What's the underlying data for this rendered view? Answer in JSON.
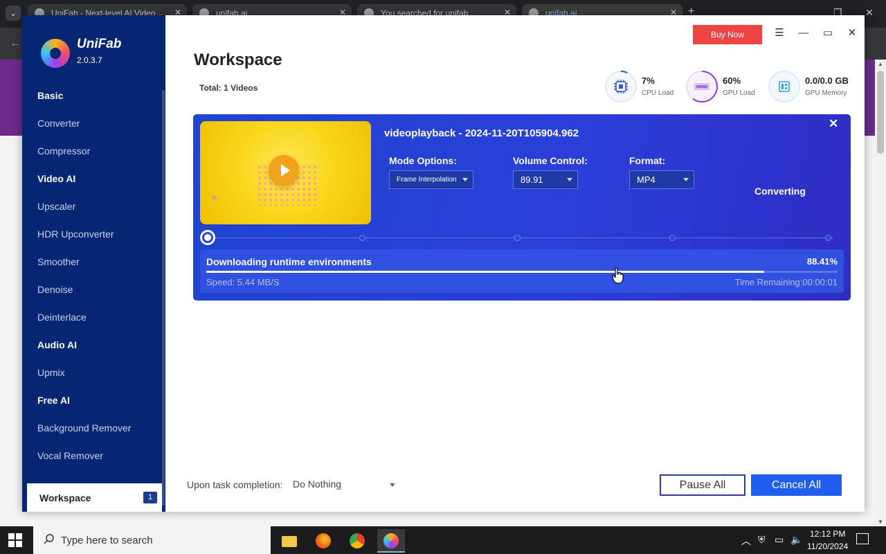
{
  "browser": {
    "tabs": [
      {
        "title": "UniFab - Next-level AI Video ...",
        "active": false
      },
      {
        "title": "unifab.ai",
        "active": false
      },
      {
        "title": "You searched for unifab ...",
        "active": false
      },
      {
        "title": "unifab.ai",
        "active": true
      }
    ]
  },
  "app": {
    "name": "UniFab",
    "version": "2.0.3.7",
    "buy_now": "Buy Now",
    "workspace_badge": "1"
  },
  "sidebar": {
    "sections": [
      {
        "title": "Basic",
        "items": [
          "Converter",
          "Compressor"
        ]
      },
      {
        "title": "Video AI",
        "items": [
          "Upscaler",
          "HDR Upconverter",
          "Smoother",
          "Denoise",
          "Deinterlace"
        ]
      },
      {
        "title": "Audio AI",
        "items": [
          "Upmix"
        ]
      },
      {
        "title": "Free AI",
        "items": [
          "Background Remover",
          "Vocal Remover"
        ]
      }
    ],
    "active_item": "Workspace"
  },
  "workspace": {
    "title": "Workspace",
    "total": "Total: 1 Videos"
  },
  "stats": [
    {
      "value": "7%",
      "label": "CPU Load",
      "percent": 7,
      "color": "#2a55d4"
    },
    {
      "value": "60%",
      "label": "GPU Load",
      "percent": 60,
      "color": "#8a3ed8"
    },
    {
      "value": "0.0/0.0 GB",
      "label": "GPU Memory",
      "percent": 0,
      "color": "#2aa6e8"
    }
  ],
  "task": {
    "video_name": "videoplayback - 2024-11-20T105904.962",
    "mode_label": "Mode Options:",
    "mode_value": "Frame Interpolation",
    "volume_label": "Volume Control:",
    "volume_value": "89.91",
    "format_label": "Format:",
    "format_value": "MP4",
    "status": "Converting",
    "progress_title": "Downloading runtime environments",
    "progress_percent_text": "88.41%",
    "progress_fraction": 0.8841,
    "speed": "Speed: 5.44 MB/S",
    "time_remaining": "Time Remaining:00:00:01"
  },
  "footer": {
    "completion_label": "Upon task completion:",
    "completion_value": "Do Nothing",
    "pause_all": "Pause All",
    "cancel_all": "Cancel All"
  },
  "taskbar": {
    "search_placeholder": "Type here to search",
    "time": "12:12 PM",
    "date": "11/20/2024"
  }
}
